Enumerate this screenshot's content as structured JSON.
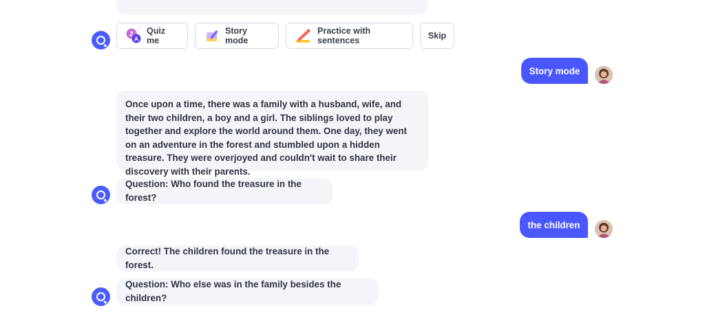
{
  "options": {
    "quiz_label": "Quiz me",
    "story_label": "Story mode",
    "practice_label": "Practice with sentences",
    "skip_label": "Skip"
  },
  "messages": {
    "user_story_mode": "Story mode",
    "story_text": "Once upon a time, there was a family with a husband, wife, and their two children, a boy and a girl. The siblings loved to play together and explore the world around them. One day, they went on an adventure in the forest and stumbled upon a hidden treasure. They were overjoyed and couldn't wait to share their discovery with their parents.",
    "question_1": "Question: Who found the treasure in the forest?",
    "user_answer_1": "the children",
    "feedback_1": "Correct! The children found the treasure in the forest.",
    "question_2": "Question: Who else was in the family besides the children?"
  },
  "colors": {
    "accent": "#4a57ff",
    "bubble_bg": "#f3f5f9",
    "option_border": "#d5d9e2"
  },
  "icons": {
    "bot": "bot-logo-icon",
    "quiz": "translate-icon",
    "story": "notebook-pencil-icon",
    "practice": "pencil-icon"
  }
}
